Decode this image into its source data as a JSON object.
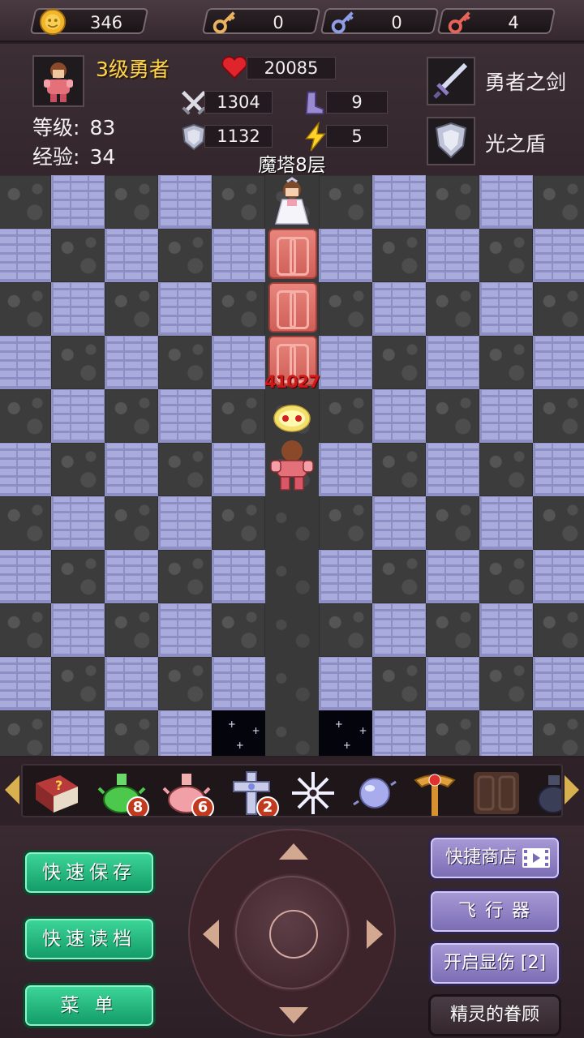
{
  "resources": {
    "gold": "346",
    "yellow_key": "0",
    "blue_key": "0",
    "red_key": "4"
  },
  "hero": {
    "rank": "3级勇者",
    "level_label": "等级:",
    "level": "83",
    "exp_label": "经验:",
    "exp": "34",
    "hp": "20085",
    "attack": "1304",
    "defense": "1132",
    "agility": "9",
    "speed": "5",
    "weapon": "勇者之剑",
    "shield": "光之盾",
    "floor": "魔塔8层"
  },
  "board": {
    "damage_label": "41027"
  },
  "items": [
    {
      "name": "monster-book",
      "count": ""
    },
    {
      "name": "green-potion",
      "count": "8"
    },
    {
      "name": "pink-potion",
      "count": "6"
    },
    {
      "name": "cross-holy-water",
      "count": "2"
    },
    {
      "name": "snowflake-crystal",
      "count": ""
    },
    {
      "name": "fly-orb",
      "count": ""
    },
    {
      "name": "magic-key-staff",
      "count": ""
    },
    {
      "name": "door-item",
      "count": ""
    },
    {
      "name": "dark-vase",
      "count": ""
    }
  ],
  "buttons": {
    "quick_save": "快速保存",
    "quick_load": "快速读档",
    "menu": "菜 单",
    "quick_shop": "快捷商店",
    "flyer": "飞 行 器",
    "show_damage": "开启显伤 [2]",
    "fairy": "精灵的眷顾"
  },
  "colors": {
    "rank": "#ffd64a",
    "damage": "#d01818",
    "green_button": "#1fb57b",
    "purple_button": "#8f81c8"
  }
}
